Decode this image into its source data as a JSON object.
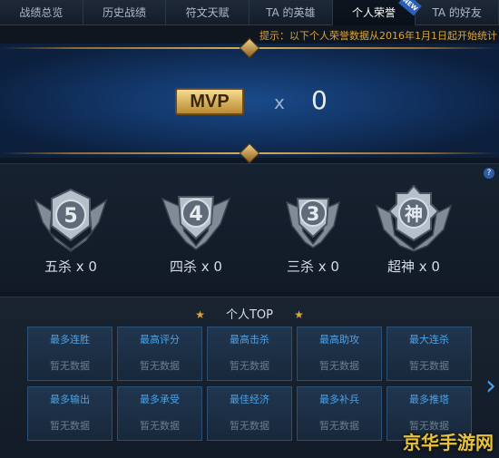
{
  "tabs": [
    {
      "label": "战绩总览"
    },
    {
      "label": "历史战绩"
    },
    {
      "label": "符文天赋"
    },
    {
      "label": "TA 的英雄"
    },
    {
      "label": "个人荣誉"
    },
    {
      "label": "TA 的好友"
    }
  ],
  "active_tab": "个人荣誉",
  "new_badge": "NEW",
  "tip": "提示：以下个人荣誉数据从2016年1月1日起开始统计",
  "mvp": {
    "badge": "MVP",
    "x": "x",
    "count": "0"
  },
  "help": "?",
  "medals": [
    {
      "glyph": "5",
      "label": "五杀 x 0",
      "icon": "penta-kill-medal-icon"
    },
    {
      "glyph": "4",
      "label": "四杀 x 0",
      "icon": "quadra-kill-medal-icon"
    },
    {
      "glyph": "3",
      "label": "三杀 x 0",
      "icon": "triple-kill-medal-icon"
    },
    {
      "glyph": "神",
      "label": "超神 x 0",
      "icon": "legendary-medal-icon"
    }
  ],
  "top": {
    "title": "个人TOP",
    "star": "★",
    "cells": [
      {
        "title": "最多连胜",
        "value": "暂无数据"
      },
      {
        "title": "最高评分",
        "value": "暂无数据"
      },
      {
        "title": "最高击杀",
        "value": "暂无数据"
      },
      {
        "title": "最高助攻",
        "value": "暂无数据"
      },
      {
        "title": "最大连杀",
        "value": "暂无数据"
      },
      {
        "title": "最多输出",
        "value": "暂无数据"
      },
      {
        "title": "最多承受",
        "value": "暂无数据"
      },
      {
        "title": "最佳经济",
        "value": "暂无数据"
      },
      {
        "title": "最多补兵",
        "value": "暂无数据"
      },
      {
        "title": "最多推塔",
        "value": "暂无数据"
      }
    ]
  },
  "next_arrow": "›",
  "watermark": "京华手游网",
  "colors": {
    "accent": "#4aa3ea",
    "gold": "#d9a441",
    "mvp_gold": "#e3bd6a"
  }
}
